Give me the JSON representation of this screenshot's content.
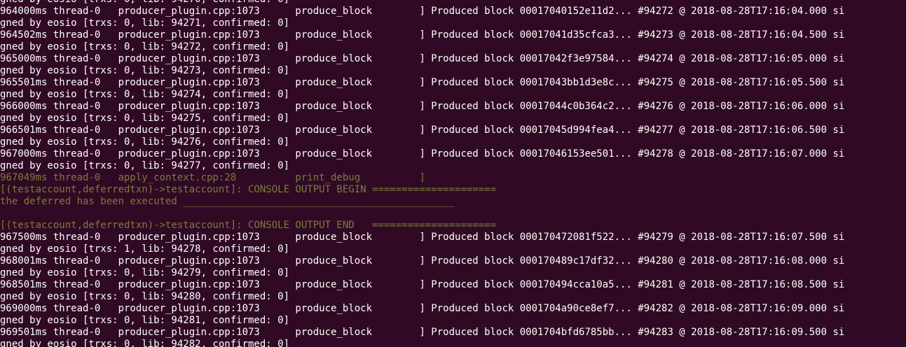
{
  "terminal": {
    "colors": {
      "background": "#300a24",
      "text": "#ffffff",
      "debug_text": "#7d7b3c"
    },
    "lines": [
      {
        "kind": "normal",
        "text": "gned by eosio [trxs: 0, lib: 94270, confirmed: 0]"
      },
      {
        "kind": "normal",
        "text": "964000ms thread-0   producer_plugin.cpp:1073      produce_block        ] Produced block 00017040152e11d2... #94272 @ 2018-08-28T17:16:04.000 si"
      },
      {
        "kind": "normal",
        "text": "gned by eosio [trxs: 0, lib: 94271, confirmed: 0]"
      },
      {
        "kind": "normal",
        "text": "964502ms thread-0   producer_plugin.cpp:1073      produce_block        ] Produced block 00017041d35cfca3... #94273 @ 2018-08-28T17:16:04.500 si"
      },
      {
        "kind": "normal",
        "text": "gned by eosio [trxs: 0, lib: 94272, confirmed: 0]"
      },
      {
        "kind": "normal",
        "text": "965000ms thread-0   producer_plugin.cpp:1073      produce_block        ] Produced block 00017042f3e97584... #94274 @ 2018-08-28T17:16:05.000 si"
      },
      {
        "kind": "normal",
        "text": "gned by eosio [trxs: 0, lib: 94273, confirmed: 0]"
      },
      {
        "kind": "normal",
        "text": "965501ms thread-0   producer_plugin.cpp:1073      produce_block        ] Produced block 00017043bb1d3e8c... #94275 @ 2018-08-28T17:16:05.500 si"
      },
      {
        "kind": "normal",
        "text": "gned by eosio [trxs: 0, lib: 94274, confirmed: 0]"
      },
      {
        "kind": "normal",
        "text": "966000ms thread-0   producer_plugin.cpp:1073      produce_block        ] Produced block 00017044c0b364c2... #94276 @ 2018-08-28T17:16:06.000 si"
      },
      {
        "kind": "normal",
        "text": "gned by eosio [trxs: 0, lib: 94275, confirmed: 0]"
      },
      {
        "kind": "normal",
        "text": "966501ms thread-0   producer_plugin.cpp:1073      produce_block        ] Produced block 00017045d994fea4... #94277 @ 2018-08-28T17:16:06.500 si"
      },
      {
        "kind": "normal",
        "text": "gned by eosio [trxs: 0, lib: 94276, confirmed: 0]"
      },
      {
        "kind": "normal",
        "text": "967000ms thread-0   producer_plugin.cpp:1073      produce_block        ] Produced block 00017046153ee501... #94278 @ 2018-08-28T17:16:07.000 si"
      },
      {
        "kind": "normal",
        "text": "gned by eosio [trxs: 0, lib: 94277, confirmed: 0]"
      },
      {
        "kind": "dim",
        "text": "967049ms thread-0   apply_context.cpp:28          print_debug          ]"
      },
      {
        "kind": "dim",
        "text": "[(testaccount,deferredtxn)->testaccount]: CONSOLE OUTPUT BEGIN ====================="
      },
      {
        "kind": "dim",
        "text": "the deferred has been executed ______________________________________________"
      },
      {
        "kind": "dim",
        "text": ""
      },
      {
        "kind": "dim",
        "text": "[(testaccount,deferredtxn)->testaccount]: CONSOLE OUTPUT END   ====================="
      },
      {
        "kind": "normal",
        "text": "967500ms thread-0   producer_plugin.cpp:1073      produce_block        ] Produced block 000170472081f522... #94279 @ 2018-08-28T17:16:07.500 si"
      },
      {
        "kind": "normal",
        "text": "gned by eosio [trxs: 1, lib: 94278, confirmed: 0]"
      },
      {
        "kind": "normal",
        "text": "968001ms thread-0   producer_plugin.cpp:1073      produce_block        ] Produced block 000170489c17df32... #94280 @ 2018-08-28T17:16:08.000 si"
      },
      {
        "kind": "normal",
        "text": "gned by eosio [trxs: 0, lib: 94279, confirmed: 0]"
      },
      {
        "kind": "normal",
        "text": "968501ms thread-0   producer_plugin.cpp:1073      produce_block        ] Produced block 00017049 4cca10a5... #94281 @ 2018-08-28T17:16:08.500 si"
      },
      {
        "kind": "normal",
        "text": "gned by eosio [trxs: 0, lib: 94280, confirmed: 0]"
      },
      {
        "kind": "normal",
        "text": "969000ms thread-0   producer_plugin.cpp:1073      produce_block        ] Produced block 0001704a90ce8ef7... #94282 @ 2018-08-28T17:16:09.000 si"
      },
      {
        "kind": "normal",
        "text": "gned by eosio [trxs: 0, lib: 94281, confirmed: 0]"
      },
      {
        "kind": "normal",
        "text": "969501ms thread-0   producer_plugin.cpp:1073      produce_block        ] Produced block 0001704bfd6785bb... #94283 @ 2018-08-28T17:16:09.500 si"
      },
      {
        "kind": "normal",
        "text": "gned by eosio [trxs: 0, lib: 94282, confirmed: 0]"
      }
    ]
  }
}
